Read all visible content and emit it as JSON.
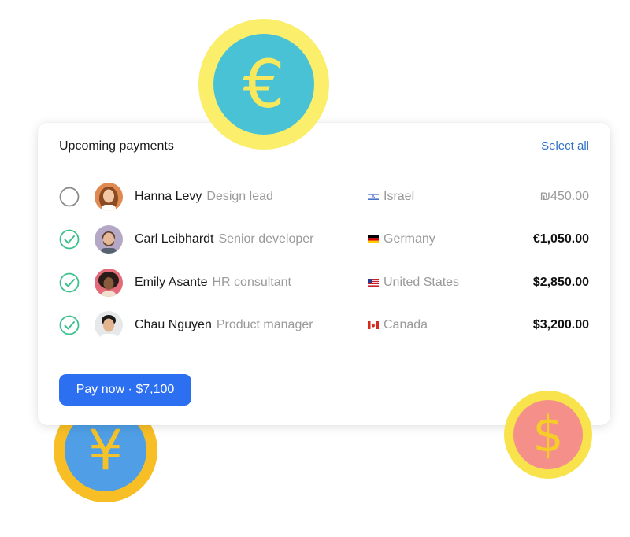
{
  "card": {
    "title": "Upcoming payments",
    "select_all": "Select all"
  },
  "rows": [
    {
      "name": "Hanna Levy",
      "role": "Design lead",
      "country": "Israel",
      "amount": "₪450.00",
      "checked": false,
      "flag_icon": "israel-flag-icon"
    },
    {
      "name": "Carl Leibhardt",
      "role": "Senior developer",
      "country": "Germany",
      "amount": "€1,050.00",
      "checked": true,
      "flag_icon": "germany-flag-icon"
    },
    {
      "name": "Emily Asante",
      "role": "HR consultant",
      "country": "United States",
      "amount": "$2,850.00",
      "checked": true,
      "flag_icon": "usa-flag-icon"
    },
    {
      "name": "Chau Nguyen",
      "role": "Product manager",
      "country": "Canada",
      "amount": "$3,200.00",
      "checked": true,
      "flag_icon": "canada-flag-icon"
    }
  ],
  "pay_button": "Pay now · $7,100",
  "coins": {
    "euro": "€",
    "yen": "¥",
    "dollar": "$"
  },
  "colors": {
    "accent": "#2d6ff1",
    "link": "#2f72c9",
    "check": "#3cc08c"
  }
}
